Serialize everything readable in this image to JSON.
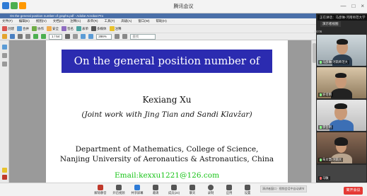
{
  "meeting": {
    "title": "腾讯会议",
    "controls": [
      "—",
      "□",
      "×"
    ],
    "leave_label": "离开会议",
    "status_text": "演讲者窗口 · 视频会话中自动调节"
  },
  "acrobat": {
    "window_title": "On the general position number of graphs.pdf - Adobe Acrobat Pro",
    "menu": [
      "文件(F)",
      "编辑(E)",
      "视图(V)",
      "文档(D)",
      "注释(C)",
      "表单(R)",
      "工具(T)",
      "高级(A)",
      "窗口(W)",
      "帮助(H)"
    ],
    "toolbar1": [
      "创建",
      "合并",
      "协作",
      "安全",
      "签名",
      "表单",
      "多媒体",
      "注释"
    ],
    "page_indicator": "1 / 54",
    "zoom": "286%",
    "search_placeholder": "查找"
  },
  "slide": {
    "title": "On the general position number of graphs",
    "author": "Kexiang Xu",
    "coauthors": "(Joint work with Jing Tian and Sandi Klavžar)",
    "department": "Department of Mathematics, College of Science,",
    "university": "Nanjing University of Aeronautics & Astronautics, China",
    "email": "Email:kexxu1221@126.com"
  },
  "panel": {
    "speaking": "正在讲话：马彦琳-河南师范大学",
    "screen_button": "演示者视图",
    "time": "34:06",
    "participants": [
      {
        "name": "马彦琳-河南师范大"
      },
      {
        "name": "许可明"
      },
      {
        "name": "李哲明"
      },
      {
        "name": "朱文慧-河南大"
      },
      {
        "name": "马敏"
      }
    ]
  },
  "bottom_toolbar": [
    "解除静音",
    "开启视频",
    "共享屏幕",
    "邀请",
    "成员(24)",
    "聊天",
    "录制",
    "应用",
    "设置"
  ],
  "colors": {
    "banner": "#2b2bb0",
    "email": "#18c418",
    "leave": "#e53935"
  }
}
